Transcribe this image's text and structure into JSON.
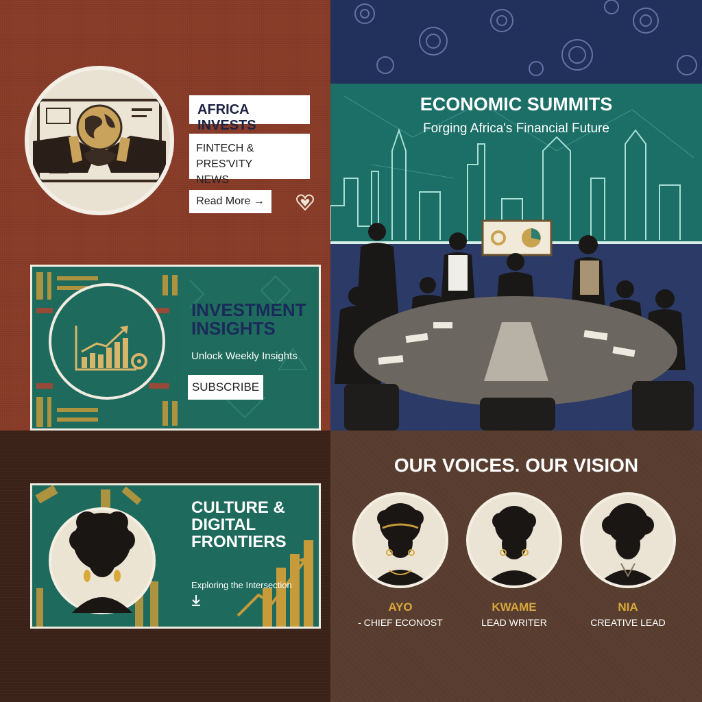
{
  "africa": {
    "title": "AFRICA INVESTS",
    "subtitle_line1": "FINTECH & PRES'VITY",
    "subtitle_line2": "NEWS",
    "cta": "Read More →"
  },
  "insights": {
    "title_line1": "INVESTMENT",
    "title_line2": "INSIGHTS",
    "subtitle": "Unlock Weekly Insights",
    "cta": "SUBSCRIBE"
  },
  "summit": {
    "title": "ECONOMIC SUMMITS",
    "subtitle": "Forging Africa's Financial Future"
  },
  "culture": {
    "title_line1": "CULTURE &",
    "title_line2": "DIGITAL",
    "title_line3": "FRONTIERS",
    "subtitle": "Exploring the Intersection"
  },
  "voices": {
    "title": "OUR VOICES. OUR VISION",
    "people": [
      {
        "name": "AYO",
        "role": "- CHIEF ECONOST"
      },
      {
        "name": "KWAME",
        "role": "LEAD WRITER"
      },
      {
        "name": "NIA",
        "role": "CREATIVE LEAD"
      }
    ]
  },
  "colors": {
    "rust": "#8c3e2a",
    "navy": "#23305a",
    "teal": "#1e6a5c",
    "gold": "#d9a83b",
    "brown": "#5a3f31"
  }
}
